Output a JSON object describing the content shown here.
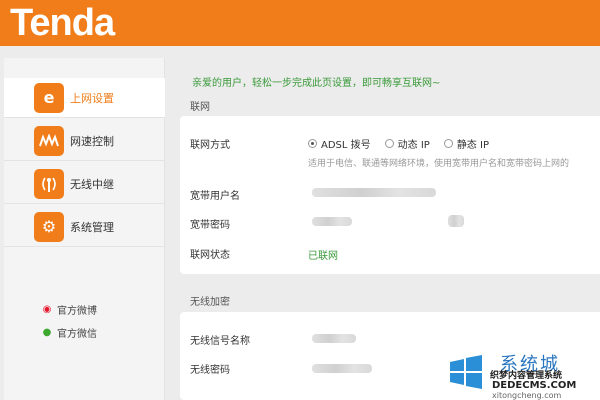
{
  "brand": {
    "logo_text": "Tenda",
    "accent_color": "#f07d1a",
    "success_color": "#3a9a3a"
  },
  "sidebar": {
    "items": [
      {
        "label": "上网设置",
        "icon": "internet-explorer-icon",
        "active": true
      },
      {
        "label": "网速控制",
        "icon": "speed-wave-icon",
        "active": false
      },
      {
        "label": "无线中继",
        "icon": "wireless-antenna-icon",
        "active": false
      },
      {
        "label": "系统管理",
        "icon": "gear-icon",
        "active": false
      }
    ],
    "social": [
      {
        "label": "官方微博",
        "icon": "weibo-icon"
      },
      {
        "label": "官方微信",
        "icon": "wechat-icon"
      }
    ]
  },
  "main": {
    "welcome": "亲爱的用户，轻松一步完成此页设置，即可畅享互联网~",
    "internet_section": {
      "title": "联网",
      "connection_label": "联网方式",
      "options": [
        {
          "label": "ADSL 拨号",
          "checked": true
        },
        {
          "label": "动态 IP",
          "checked": false
        },
        {
          "label": "静态 IP",
          "checked": false
        }
      ],
      "hint": "适用于电信、联通等网络环境，使用宽带用户名和宽带密码上网的",
      "username_label": "宽带用户名",
      "password_label": "宽带密码",
      "status_label": "联网状态",
      "status_value": "已联网"
    },
    "wireless_section": {
      "title": "无线加密",
      "ssid_label": "无线信号名称",
      "password_label": "无线密码"
    }
  },
  "watermark": {
    "line1": "系统城",
    "line2": "织梦内容管理系统",
    "line3": "DEDECMS.COM",
    "line4": "xitongcheng.com"
  }
}
